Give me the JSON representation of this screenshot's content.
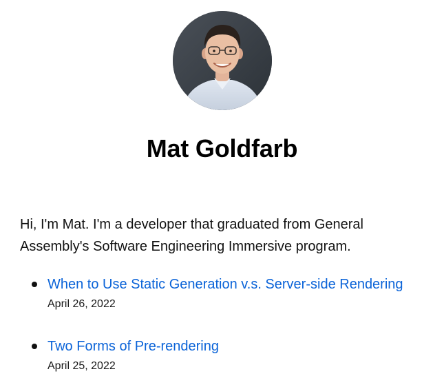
{
  "profile": {
    "name": "Mat Goldfarb",
    "avatar_icon": "profile-photo"
  },
  "intro": {
    "text": "Hi, I'm Mat. I'm a developer that graduated from General Assembly's Software Engineering Immersive program."
  },
  "posts": [
    {
      "title": "When to Use Static Generation v.s. Server-side Rendering",
      "date": "April 26, 2022"
    },
    {
      "title": "Two Forms of Pre-rendering",
      "date": "April 25, 2022"
    }
  ],
  "colors": {
    "link": "#0a63d8",
    "text": "#111111",
    "background": "#ffffff"
  }
}
